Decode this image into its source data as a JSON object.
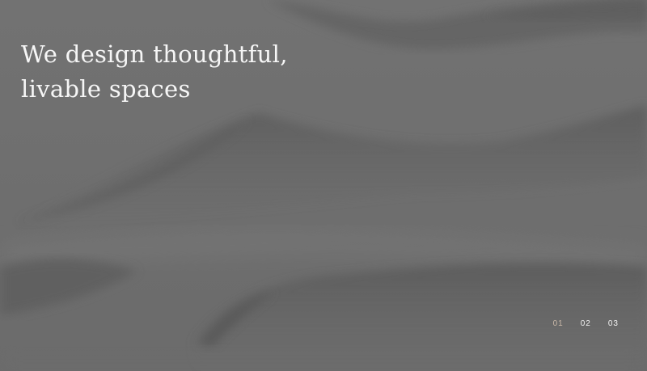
{
  "hero": {
    "headline_line1": "We design thoughtful,",
    "headline_line2": "livable spaces"
  },
  "pager": {
    "items": [
      "01",
      "02",
      "03"
    ],
    "active_index": 0,
    "active_color": "#c9b8a8"
  },
  "colors": {
    "background": "#707070",
    "text": "#f6f6f6"
  }
}
